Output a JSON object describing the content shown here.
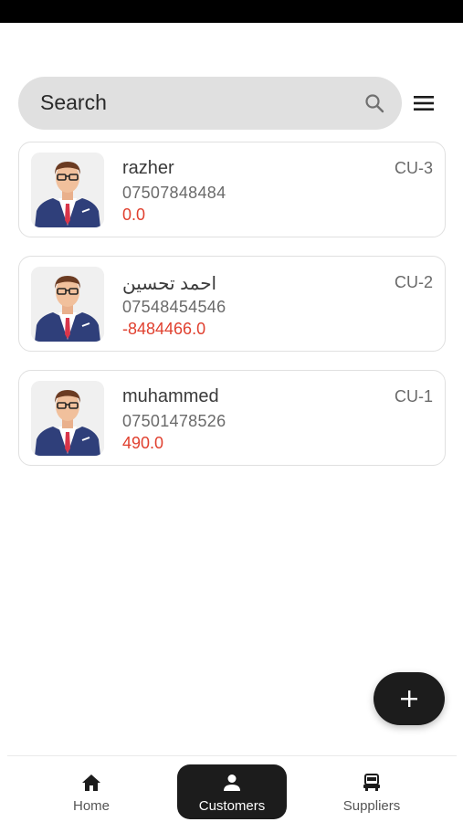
{
  "search": {
    "placeholder": "Search",
    "icon": "search-icon"
  },
  "header": {
    "menu_icon": "menu-icon"
  },
  "customers": [
    {
      "name": "razher",
      "phone": "07507848484",
      "balance": "0.0",
      "code": "CU-3"
    },
    {
      "name": "احمد تحسين",
      "phone": "07548454546",
      "balance": "-8484466.0",
      "code": "CU-2"
    },
    {
      "name": "muhammed",
      "phone": "07501478526",
      "balance": "490.0",
      "code": "CU-1"
    }
  ],
  "fab": {
    "icon": "plus-icon"
  },
  "nav": {
    "items": [
      {
        "label": "Home",
        "icon": "home-icon"
      },
      {
        "label": "Customers",
        "icon": "person-icon",
        "active": true
      },
      {
        "label": "Suppliers",
        "icon": "truck-icon"
      }
    ]
  },
  "colors": {
    "balance": "#e0402f",
    "active_nav": "#1c1c1c",
    "search_bg": "#e0e0e0"
  }
}
